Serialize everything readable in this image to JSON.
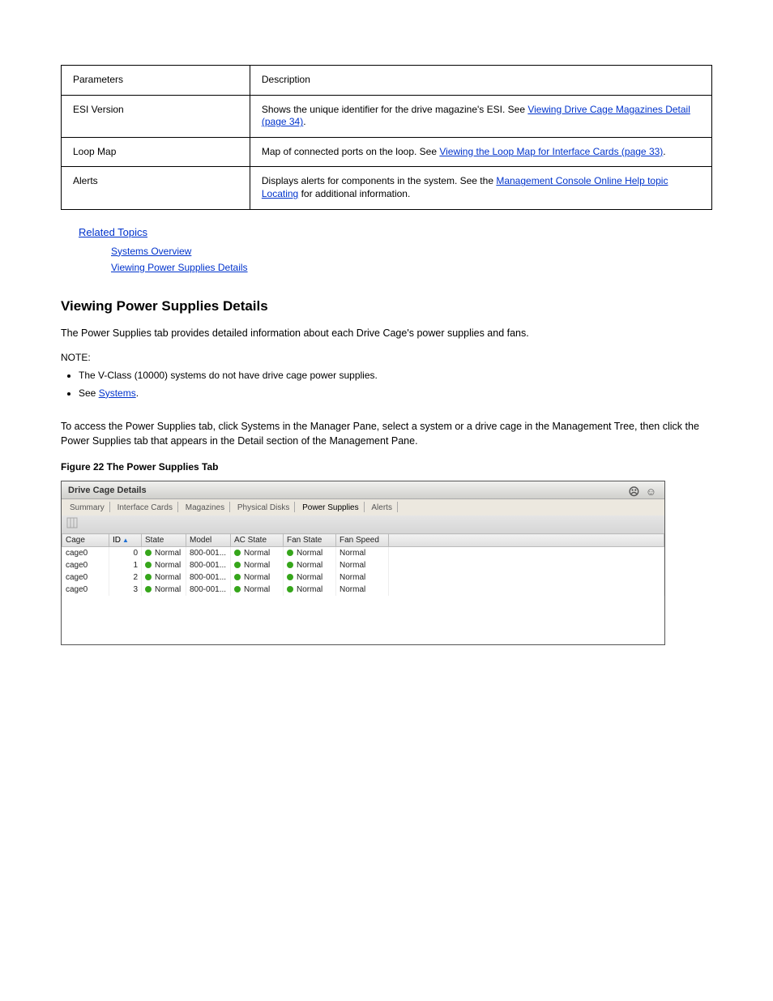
{
  "parameters": [
    {
      "name": "Parameters",
      "desc": "Description"
    },
    {
      "name": "ESI Version",
      "descPrefix": "Shows the unique identifier for the drive magazine's ESI. See ",
      "link": "Viewing Drive Cage Magazines Detail (page 34)",
      "descSuffix": "."
    },
    {
      "name": "Loop Map",
      "descPrefix": "Map of connected ports on the loop. See ",
      "link": "Viewing the Loop Map for Interface Cards (page 33)",
      "descSuffix": "."
    },
    {
      "name": "Alerts",
      "descPrefix": "Displays alerts for components in the system. See the ",
      "link": "Management Console Online Help topic Locating",
      "descSuffix": " for additional information."
    }
  ],
  "related": {
    "label": "Related Topics",
    "items": [
      {
        "text": "Systems Overview"
      },
      {
        "text": "Viewing Power Supplies Details"
      }
    ]
  },
  "section": {
    "title": "Viewing Power Supplies Details",
    "para1": "The Power Supplies tab provides detailed information about each Drive Cage's power supplies and fans.",
    "noteHead": "NOTE:",
    "noteItems": [
      {
        "plain": "The V-Class (10000) systems do not have drive cage power supplies."
      },
      {
        "prefix": "See ",
        "link": "Systems",
        "suffix": "."
      }
    ],
    "para2": "To access the Power Supplies tab, click Systems in the Manager Pane, select a system or a drive cage in the Management Tree, then click the Power Supplies tab that appears in the Detail section of the Management Pane.",
    "figCap": "Figure 22 The Power Supplies Tab"
  },
  "shot": {
    "title": "Drive Cage Details",
    "tabs": [
      "Summary",
      "Interface Cards",
      "Magazines",
      "Physical Disks",
      "Power Supplies",
      "Alerts"
    ],
    "activeTab": "Power Supplies",
    "columns": [
      "Cage",
      "ID",
      "State",
      "Model",
      "AC State",
      "Fan State",
      "Fan Speed"
    ],
    "rows": [
      {
        "cage": "cage0",
        "id": "0",
        "state": "Normal",
        "model": "800-001...",
        "ac": "Normal",
        "fan": "Normal",
        "speed": "Normal"
      },
      {
        "cage": "cage0",
        "id": "1",
        "state": "Normal",
        "model": "800-001...",
        "ac": "Normal",
        "fan": "Normal",
        "speed": "Normal"
      },
      {
        "cage": "cage0",
        "id": "2",
        "state": "Normal",
        "model": "800-001...",
        "ac": "Normal",
        "fan": "Normal",
        "speed": "Normal"
      },
      {
        "cage": "cage0",
        "id": "3",
        "state": "Normal",
        "model": "800-001...",
        "ac": "Normal",
        "fan": "Normal",
        "speed": "Normal"
      }
    ]
  }
}
